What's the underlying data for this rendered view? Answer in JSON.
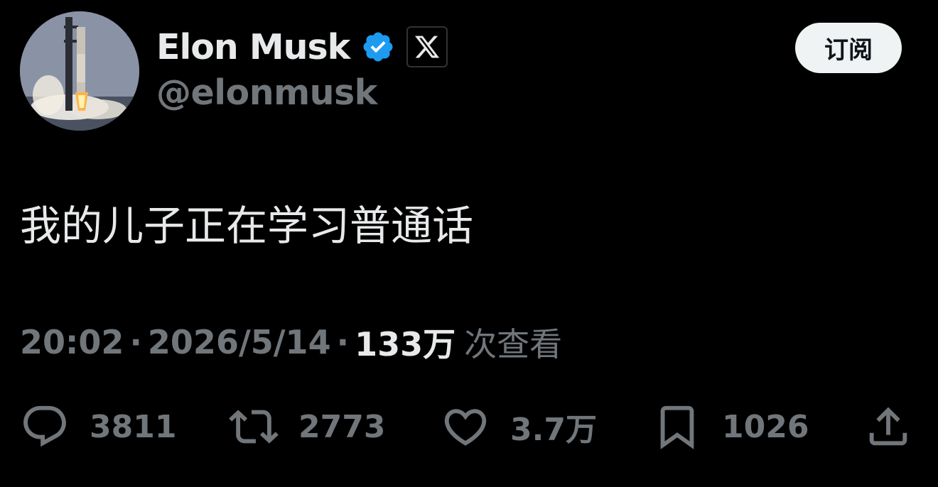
{
  "author": {
    "display_name": "Elon Musk",
    "handle": "@elonmusk",
    "verified": true,
    "verified_color": "#1d9bf0",
    "affiliate_badge": "x-logo-icon"
  },
  "header": {
    "subscribe_label": "订阅"
  },
  "tweet": {
    "text": "我的儿子正在学习普通话",
    "time": "20:02",
    "separator": "·",
    "date": "2026/5/14",
    "views_count": "133万",
    "views_label": "次查看"
  },
  "actions": {
    "replies": "3811",
    "reposts": "2773",
    "likes": "3.7万",
    "bookmarks": "1026"
  },
  "colors": {
    "background": "#000000",
    "text_primary": "#e7e9ea",
    "text_secondary": "#71767b",
    "button_bg": "#eff3f4"
  }
}
